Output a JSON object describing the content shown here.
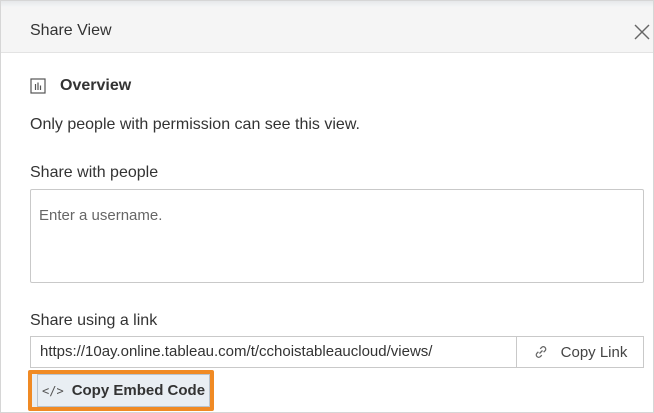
{
  "dialog": {
    "title": "Share View",
    "close_icon": "close-icon"
  },
  "overview": {
    "icon": "view-icon",
    "label": "Overview"
  },
  "permission_text": "Only people with permission can see this view.",
  "share_people": {
    "label": "Share with people",
    "placeholder": "Enter a username.",
    "value": ""
  },
  "share_link": {
    "label": "Share using a link",
    "url": "https://10ay.online.tableau.com/t/cchoistableaucloud/views/",
    "copy_link_label": "Copy Link",
    "copy_link_icon": "link-icon"
  },
  "embed": {
    "icon": "</>",
    "label": "Copy Embed Code",
    "highlight_color": "#f08a24"
  }
}
